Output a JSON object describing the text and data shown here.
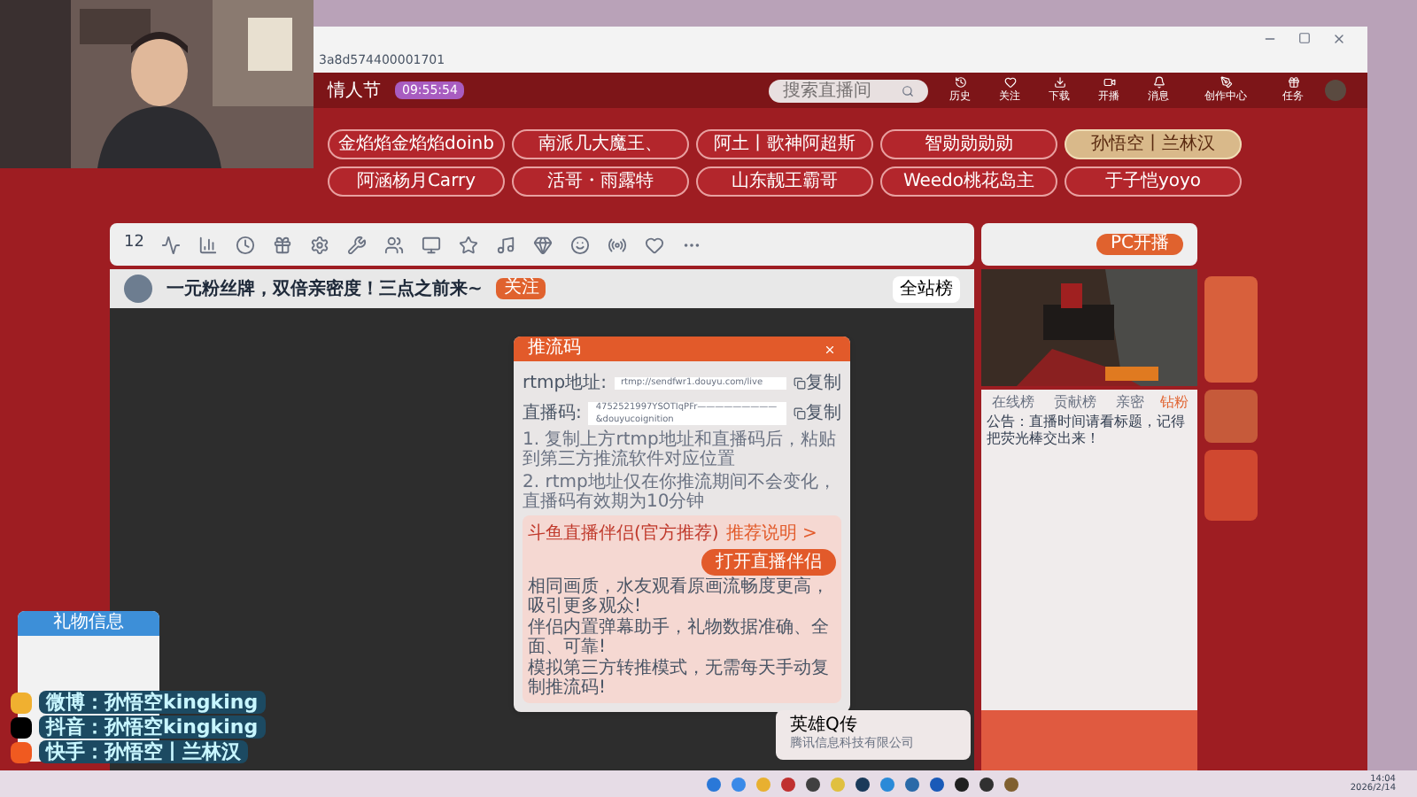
{
  "browser": {
    "url": "3a8d574400001701"
  },
  "site_header": {
    "nav": "情人节",
    "timer": "09:55:54",
    "search": {
      "placeholder": "搜索直播间"
    },
    "icons": [
      "历史",
      "关注",
      "下载",
      "开播",
      "消息",
      "创作中心",
      "任务"
    ]
  },
  "banner": [
    {
      "label": "金焰焰金焰焰doinb",
      "selected": false
    },
    {
      "label": "南派几大魔王、",
      "selected": false
    },
    {
      "label": "阿土丨歌神阿超斯",
      "selected": false
    },
    {
      "label": "智勋勋勋勋",
      "selected": false
    },
    {
      "label": "孙悟空丨兰林汉",
      "selected": true
    },
    {
      "label": "阿涵杨月Carry",
      "selected": false
    },
    {
      "label": "活哥・雨露特",
      "selected": false
    },
    {
      "label": "山东靓王霸哥",
      "selected": false
    },
    {
      "label": "Weedo桃花岛主",
      "selected": false
    },
    {
      "label": "于子恺yoyo",
      "selected": false
    }
  ],
  "toolbar": {
    "score": "12",
    "pc_button": "PC开播"
  },
  "stream": {
    "title": "一元粉丝牌，双倍亲密度！三点之前来~",
    "follow": "关注",
    "side": [
      "全站榜"
    ]
  },
  "dialog": {
    "title": "推流码",
    "rows": [
      {
        "label": "rtmp地址:",
        "value": "rtmp://sendfwr1.douyu.com/live",
        "copy": "复制"
      },
      {
        "label": "直播码:",
        "value": "4752521997YSOTIqPFr—————————&douyucoignition",
        "copy": "复制"
      }
    ],
    "notes": [
      "1. 复制上方rtmp地址和直播码后，粘贴到第三方推流软件对应位置",
      "2. rtmp地址仅在你推流期间不会变化，直播码有效期为10分钟"
    ],
    "promo": {
      "title": "斗鱼直播伴侣(官方推荐)",
      "link": "推荐说明 >",
      "button": "打开直播伴侣",
      "lines": [
        "相同画质，水友观看原画流畅度更高，吸引更多观众!",
        "伴侣内置弹幕助手，礼物数据准确、全面、可靠!",
        "模拟第三方转推模式，无需每天手动复制推流码!"
      ]
    }
  },
  "chat": {
    "tabs": [
      {
        "label": "在线榜",
        "selected": false
      },
      {
        "label": "贡献榜",
        "selected": false
      },
      {
        "label": "亲密",
        "selected": false
      },
      {
        "label": "钻粉",
        "selected": true
      }
    ],
    "notice": "公告：直播时间请看标题，记得把荧光棒交出来！"
  },
  "gift_panel": {
    "title": "礼物信息"
  },
  "overlay": [
    {
      "kind": "weibo",
      "text": "微博：孙悟空kingking"
    },
    {
      "kind": "douyin",
      "text": "抖音：孙悟空kingking"
    },
    {
      "kind": "kuaishou",
      "text": "快手：孙悟空丨兰林汉"
    }
  ],
  "notification": {
    "title": "英雄Q传",
    "subtitle": "腾讯信息科技有限公司"
  },
  "taskbar": {
    "time": "14:04",
    "date": "2026/2/14"
  }
}
